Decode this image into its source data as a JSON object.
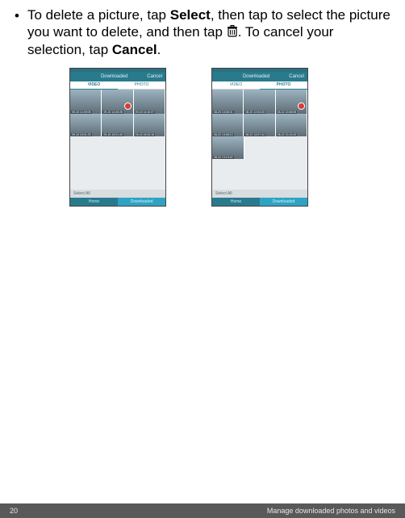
{
  "instruction": {
    "bullet": "•",
    "part1": "To delete a picture, tap ",
    "bold1": "Select",
    "part2": ", then tap to select the picture you want to delete, and then tap ",
    "part3": ". To cancel your selection, tap ",
    "bold2": "Cancel",
    "part4": "."
  },
  "screens": {
    "left": {
      "header_title": "Downloaded",
      "header_action": "Cancel",
      "tab_video": "VIDEO",
      "tab_photo": "PHOTO",
      "tab_active": "video",
      "row1": [
        "09-15 14:39:05",
        "09-15 14:40:28",
        "09-15 14:40:37"
      ],
      "row2": [
        "09-15 15:01:33",
        "09-15 15:01:40",
        "09-15 15:02:16"
      ],
      "selected_index": 1,
      "select_all": "Select All",
      "bottom_home": "Home",
      "bottom_downloaded": "Downloaded"
    },
    "right": {
      "header_title": "Downloaded",
      "header_action": "Cancel",
      "tab_video": "VIDEO",
      "tab_photo": "PHOTO",
      "tab_active": "photo",
      "row1": [
        "08-20 13:08:31",
        "08-20 13:04:33",
        "08-22 13:06:05"
      ],
      "row2": [
        "08-22 13:08:13",
        "08-22 13:07:44",
        "08-22 13:13:43"
      ],
      "row3": [
        "08-22 13:19:42"
      ],
      "selected_index": 2,
      "select_all": "Select All",
      "bottom_home": "Home",
      "bottom_downloaded": "Downloaded"
    }
  },
  "footer": {
    "page_number": "20",
    "section_title": "Manage downloaded photos and videos"
  }
}
